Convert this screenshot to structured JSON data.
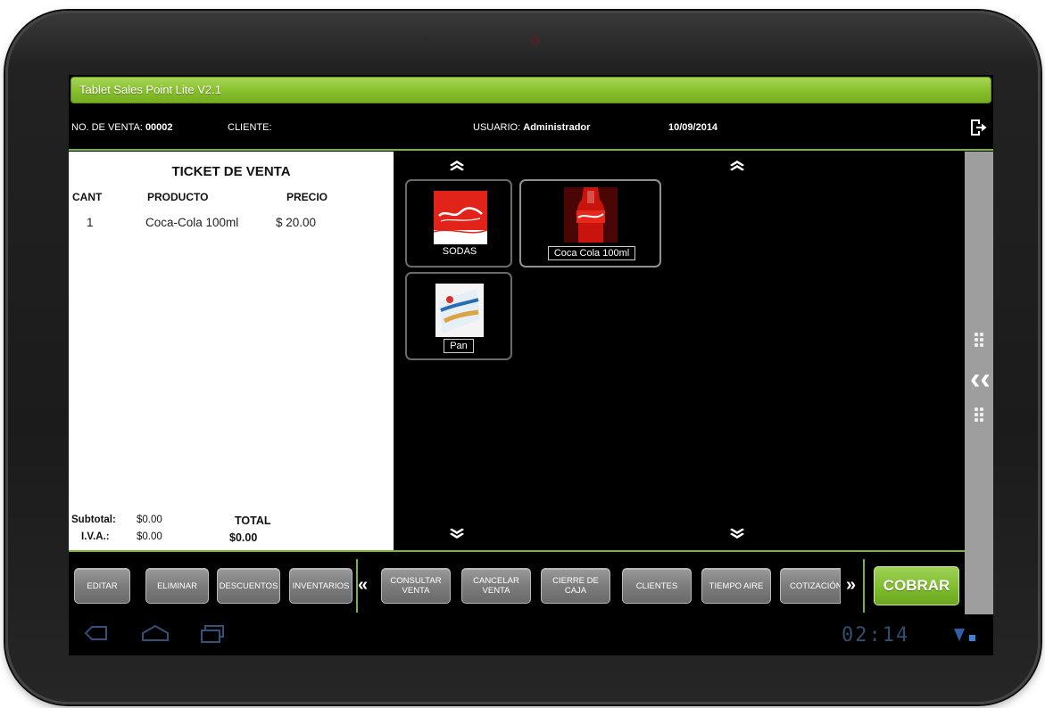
{
  "app": {
    "title": "Tablet Sales Point Lite V2.1"
  },
  "info": {
    "sale_no_label": "NO. DE VENTA:",
    "sale_no_value": "00002",
    "client_label": "CLIENTE:",
    "user_label": "USUARIO:",
    "user_value": "Administrador",
    "date": "10/09/2014"
  },
  "ticket": {
    "title": "TICKET DE VENTA",
    "columns": {
      "qty": "CANT",
      "product": "PRODUCTO",
      "price": "PRECIO"
    },
    "rows": [
      {
        "qty": "1",
        "product": "Coca-Cola 100ml",
        "price": "$ 20.00"
      }
    ],
    "subtotal_label": "Subtotal:",
    "subtotal_value": "$0.00",
    "iva_label": "I.V.A.:",
    "iva_value": "$0.00",
    "total_label": "TOTAL",
    "total_value": "$0.00"
  },
  "grid": {
    "categories": [
      {
        "label": "SODAS",
        "icon": "coca-cola-logo-icon"
      },
      {
        "label": "Pan",
        "icon": "bread-package-icon"
      }
    ],
    "products": [
      {
        "label": "Coca Cola 100ml",
        "icon": "coca-cola-bottle-icon",
        "selected": true
      }
    ]
  },
  "toolbar": {
    "left_buttons": [
      "EDITAR",
      "ELIMINAR",
      "DESCUENTOS",
      "INVENTARIOS"
    ],
    "right_buttons": [
      "CONSULTAR\nVENTA",
      "CANCELAR\nVENTA",
      "CIERRE DE\nCAJA",
      "CLIENTES",
      "TIEMPO AIRE",
      "COTIZACIÓN"
    ],
    "scroll_left": "«",
    "scroll_right": "»",
    "cobrar": "COBRAR"
  },
  "system": {
    "clock": "02:14"
  },
  "colors": {
    "accent": "#7ab52a",
    "button_gray": "#7c7c7c",
    "background": "#000000"
  }
}
